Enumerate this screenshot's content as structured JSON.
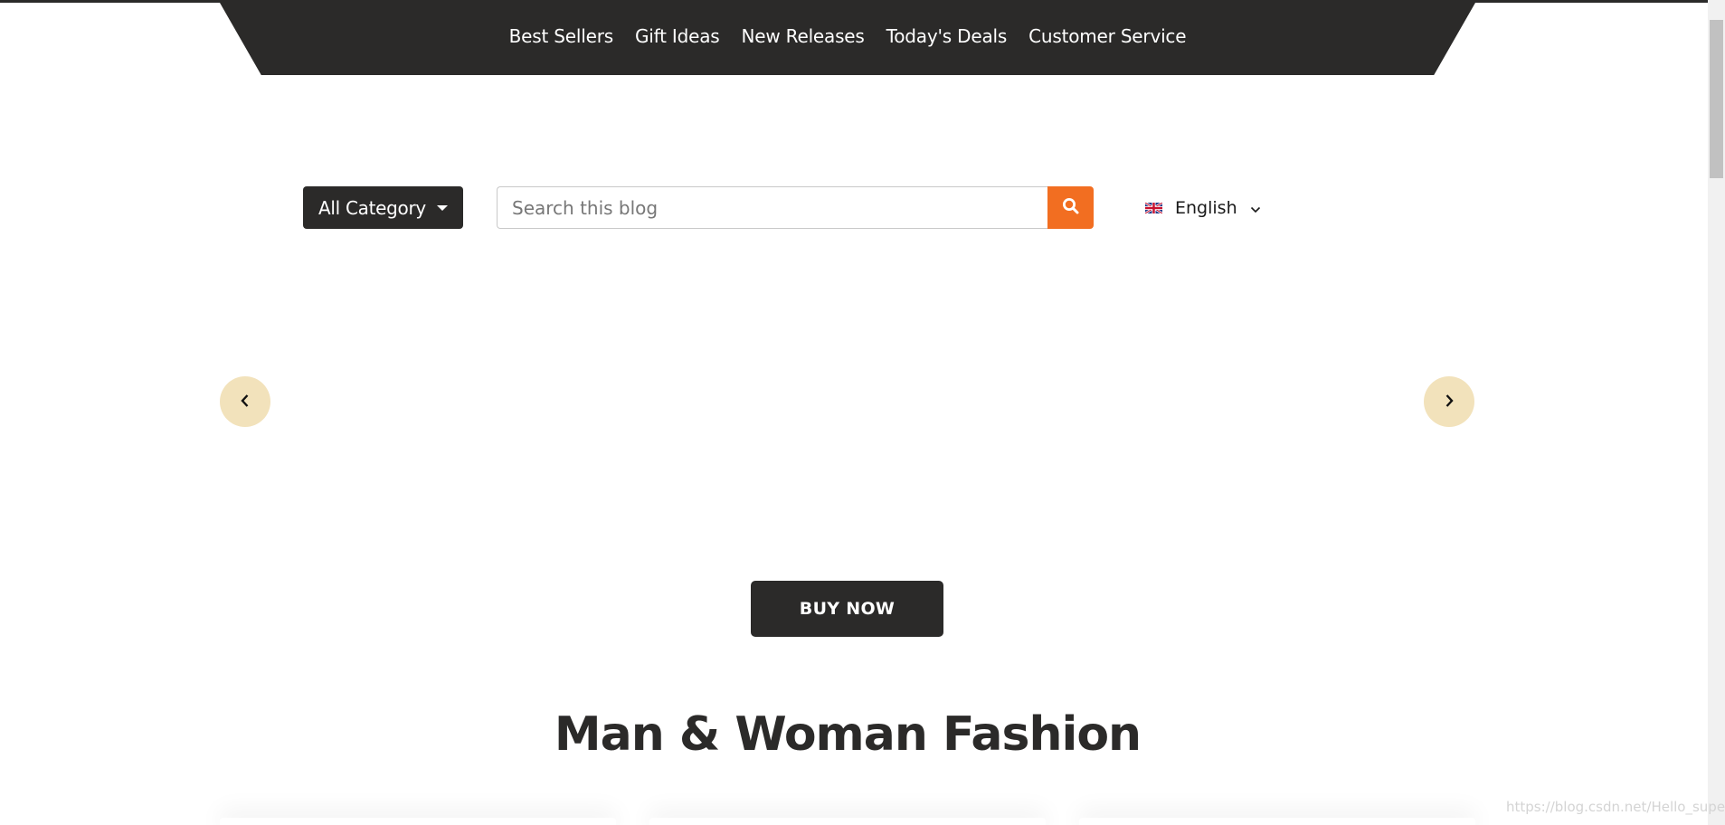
{
  "nav": {
    "items": [
      {
        "label": "Best Sellers"
      },
      {
        "label": "Gift Ideas"
      },
      {
        "label": "New Releases"
      },
      {
        "label": "Today's Deals"
      },
      {
        "label": "Customer Service"
      }
    ]
  },
  "search": {
    "category_label": "All Category",
    "placeholder": "Search this blog",
    "value": "",
    "button_icon": "search-icon"
  },
  "language": {
    "selected": "English",
    "flag_icon": "uk-flag-icon"
  },
  "carousel": {
    "prev_icon": "chevron-left-icon",
    "next_icon": "chevron-right-icon"
  },
  "hero": {
    "buy_label": "BUY NOW"
  },
  "section": {
    "title": "Man & Woman Fashion"
  },
  "watermark": "https://blog.csdn.net/Hello_super",
  "colors": {
    "dark": "#2b2a29",
    "accent": "#f26e21",
    "arrow_bg": "#f2e2bb"
  }
}
